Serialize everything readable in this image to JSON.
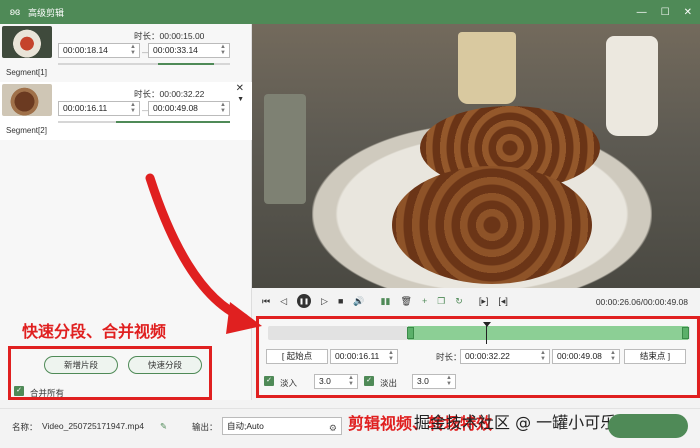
{
  "window": {
    "title": "高级剪辑",
    "minimize": "—",
    "maximize": "☐",
    "close": "✕"
  },
  "segments": [
    {
      "label": "Segment[1]",
      "duration": "时长：00:00:15.00",
      "start": "00:00:18.14",
      "end": "00:00:33.14",
      "selected": false
    },
    {
      "label": "Segment[2]",
      "duration": "时长：00:00:32.22",
      "start": "00:00:16.11",
      "end": "00:00:49.08",
      "selected": true
    }
  ],
  "separator": "—",
  "player": {
    "timecode": "00:00:26.06/00:00:49.08"
  },
  "edit": {
    "start_btn": "[  起始点",
    "start_val": "00:00:16.11",
    "duration_label": "时长：",
    "duration_val": "00:00:32.22",
    "end_val": "00:00:49.08",
    "end_btn": "结束点  ]",
    "fade_in": "淡入",
    "fade_in_val": "3.0",
    "fade_out": "淡出",
    "fade_out_val": "3.0"
  },
  "left_actions": {
    "new_segment": "新增片段",
    "quick_split": "快速分段",
    "merge_all": "合并所有"
  },
  "bottom": {
    "name_label": "名称：",
    "filename": "Video_250725171947.mp4",
    "output_label": "输出：",
    "output_value": "自动;Auto"
  },
  "annotations": {
    "left_caption": "快速分段、合并视频",
    "bottom_caption": "剪辑视频、转场特效"
  },
  "watermark": "掘金技术社区 @ 一罐小可乐",
  "colors": {
    "brand_green": "#4f8a57",
    "highlight_red": "#e02020"
  }
}
